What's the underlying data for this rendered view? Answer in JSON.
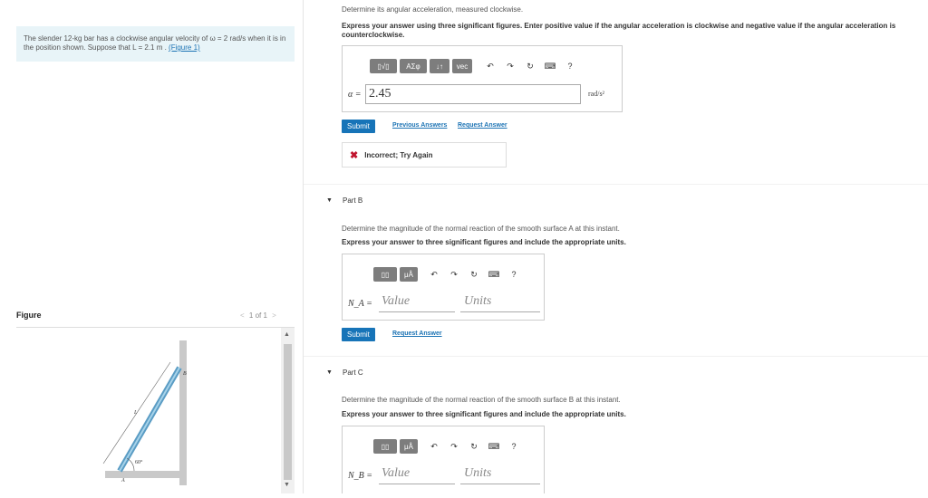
{
  "problem": {
    "text_prefix": "The slender 12-",
    "kg": "kg",
    "text_mid": " bar has a clockwise angular velocity of ω = 2 rad/s when it is in the position shown. Suppose that L = 2.1  m . ",
    "figure_link": "(Figure 1)"
  },
  "figure": {
    "label": "Figure",
    "pager_text": "1 of 1",
    "labels": {
      "L": "L",
      "A": "A",
      "B": "B",
      "angle": "60°"
    }
  },
  "part_a": {
    "question": "Determine its angular acceleration, measured clockwise.",
    "instruction": "Express your answer using three significant figures. Enter positive value if the angular acceleration is clockwise and negative value if the angular acceleration is counterclockwise.",
    "toolbar": {
      "matrix_btn": "▯√▯",
      "greek_btn": "ΑΣφ",
      "arrows_btn": "↓↑",
      "vec_btn": "vec"
    },
    "variable": "α =",
    "value": "2.45",
    "unit": "rad/s²",
    "submit": "Submit",
    "previous_answers": "Previous Answers",
    "request_answer": "Request Answer",
    "feedback": "Incorrect; Try Again"
  },
  "part_b": {
    "title": "Part B",
    "question": "Determine the magnitude of the normal reaction of the smooth surface A at this instant.",
    "instruction": "Express your answer to three significant figures and include the appropriate units.",
    "toolbar": {
      "units_btn": "μÅ"
    },
    "variable": "N_A =",
    "value_placeholder": "Value",
    "units_placeholder": "Units",
    "submit": "Submit",
    "request_answer": "Request Answer"
  },
  "part_c": {
    "title": "Part C",
    "question": "Determine the magnitude of the normal reaction of the smooth surface B at this instant.",
    "instruction": "Express your answer to three significant figures and include the appropriate units.",
    "toolbar": {
      "units_btn": "μÅ"
    },
    "variable": "N_B =",
    "value_placeholder": "Value",
    "units_placeholder": "Units"
  },
  "toolbar_common": {
    "help": "?"
  }
}
